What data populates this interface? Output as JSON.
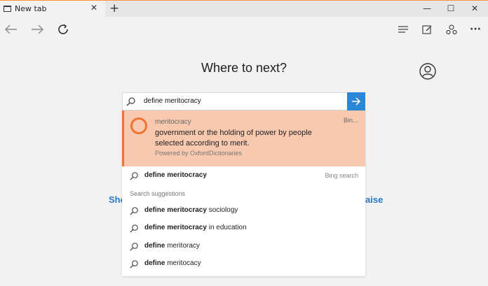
{
  "tab": {
    "title": "New tab",
    "close_glyph": "✕",
    "new_tab_glyph": "+"
  },
  "window_controls": {
    "minimize": "—",
    "maximize": "☐",
    "close": "✕"
  },
  "toolbar": {
    "back_icon": "arrow-left-icon",
    "forward_icon": "arrow-right-icon",
    "refresh_icon": "refresh-icon",
    "hub_icon": "hub-icon",
    "note_icon": "web-note-icon",
    "share_icon": "share-icon",
    "more_glyph": "···"
  },
  "page": {
    "heading": "Where to next?",
    "link_left_fragment": "Sho",
    "link_right_fragment": "aise"
  },
  "search": {
    "value": "define meritocracy",
    "go_icon": "arrow-right-icon"
  },
  "answer_card": {
    "word": "meritocracy",
    "definition": "government or the holding of power by people selected according to merit.",
    "powered_by": "Powered by OxfordDictionaries",
    "source": "Bin..."
  },
  "top_result": {
    "query": "define meritocracy",
    "meta": "Bing search"
  },
  "suggestions_label": "Search suggestions",
  "suggestions": [
    {
      "bold": "define meritocracy",
      "rest": " sociology"
    },
    {
      "bold": "define meritocracy",
      "rest": " in education"
    },
    {
      "bold": "define",
      "rest": " meritoracy"
    },
    {
      "bold": "define",
      "rest": " meritocacy"
    }
  ],
  "colors": {
    "accent_orange": "#f0742f",
    "card_bg": "#f9c9af",
    "go_button": "#2b88d8",
    "link_blue": "#2a78c4"
  }
}
